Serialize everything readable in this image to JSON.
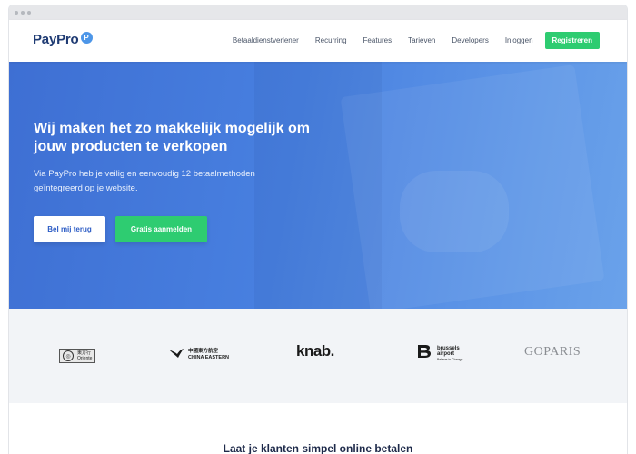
{
  "brand": {
    "logo_text": "PayPro",
    "logo_glyph": "P",
    "accent": "#2ecc71",
    "primary": "#4880e0"
  },
  "nav": {
    "links": [
      "Betaaldienstverlener",
      "Recurring",
      "Features",
      "Tarieven",
      "Developers",
      "Inloggen"
    ],
    "register_label": "Registreren"
  },
  "hero": {
    "title": "Wij maken het zo makkelijk mogelijk om jouw producten te verkopen",
    "subtitle": "Via PayPro heb je veilig en eenvoudig 12 betaalmethoden geïntegreerd op je website.",
    "call_button": "Bel mij terug",
    "signup_button": "Gratis aanmelden"
  },
  "logos": {
    "oriente_top": "東方行",
    "oriente_bottom": "Oriente",
    "oriente_glyph": "◎",
    "china_eastern_cn": "中國東方航空",
    "china_eastern_en": "CHINA EASTERN",
    "knab": "knab.",
    "brussels_line1": "brussels",
    "brussels_line2": "airport",
    "brussels_tag": "Believe in Change",
    "goparis": "GOPARIS"
  },
  "section": {
    "title": "Laat je klanten simpel online betalen"
  }
}
